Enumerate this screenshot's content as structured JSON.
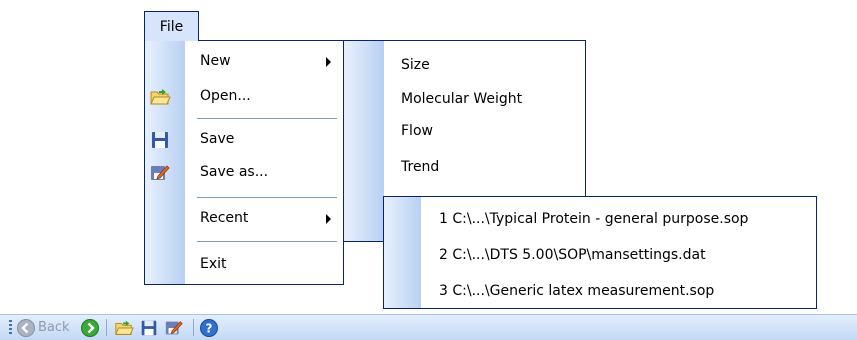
{
  "menubar": {
    "file_label": "File"
  },
  "file_menu": {
    "items": [
      {
        "label": "New",
        "icon": "none",
        "has_submenu": true
      },
      {
        "label": "Open...",
        "icon": "open-folder-icon"
      },
      {
        "label": "Save",
        "icon": "save-disk-icon"
      },
      {
        "label": "Save as...",
        "icon": "save-as-icon"
      },
      {
        "label": "Recent",
        "icon": "none",
        "has_submenu": true
      },
      {
        "label": "Exit",
        "icon": "none"
      }
    ]
  },
  "new_submenu": {
    "items": [
      {
        "label": "Size"
      },
      {
        "label": "Molecular Weight"
      },
      {
        "label": "Flow"
      },
      {
        "label": "Trend"
      }
    ]
  },
  "recent_submenu": {
    "items": [
      {
        "label": "1  C:\\...\\Typical Protein - general purpose.sop"
      },
      {
        "label": "2  C:\\...\\DTS 5.00\\SOP\\mansettings.dat"
      },
      {
        "label": "3  C:\\...\\Generic latex measurement.sop"
      }
    ]
  },
  "toolbar": {
    "back_label": "Back",
    "buttons": [
      "back-icon",
      "forward-icon",
      "open-folder-icon",
      "save-disk-icon",
      "save-as-icon",
      "help-icon"
    ]
  },
  "colors": {
    "menu_border": "#0a246a",
    "gutter_light": "#e8f1fd",
    "gutter_dark": "#b8d0f2",
    "toolbar_top": "#e3eefc",
    "toolbar_bottom": "#c4d9f5"
  }
}
